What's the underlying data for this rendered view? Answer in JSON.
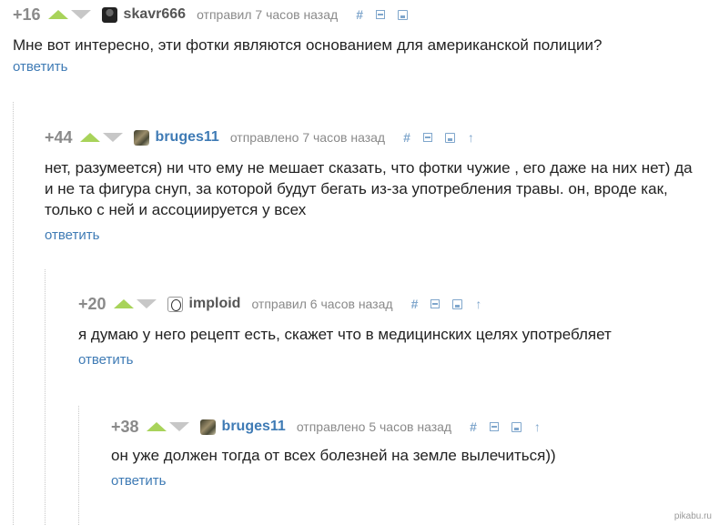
{
  "comments": [
    {
      "rating": "+16",
      "author": "skavr666",
      "meta": "отправил 7 часов назад",
      "text": "Мне вот интересно, эти фотки являются основанием для американской полиции?",
      "reply_label": "ответить",
      "hash": "#"
    },
    {
      "rating": "+44",
      "author": "bruges11",
      "meta": "отправлено 7 часов назад",
      "text": "нет, разумеется) ни что ему не мешает сказать, что фотки чужие , его даже на них нет) да и не та фигура снуп, за которой будут бегать из-за употребления травы. он, вроде как, только с ней и ассоциируется у всех",
      "reply_label": "ответить",
      "hash": "#",
      "up_arrow": "↑"
    },
    {
      "rating": "+20",
      "author": "imploid",
      "meta": "отправил 6 часов назад",
      "text": "я думаю у него рецепт есть, скажет что в медицинских целях употребляет",
      "reply_label": "ответить",
      "hash": "#",
      "up_arrow": "↑"
    },
    {
      "rating": "+38",
      "author": "bruges11",
      "meta": "отправлено 5 часов назад",
      "text": "он уже должен тогда от всех болезней на земле вылечиться))",
      "reply_label": "ответить",
      "hash": "#",
      "up_arrow": "↑"
    }
  ],
  "watermark": "pikabu.ru",
  "colors": {
    "vote_up": "#a8d35a",
    "vote_down": "#c7c7c7",
    "link": "#3f7bb5",
    "tool": "#7fa6cc",
    "meta": "#8a8a8a"
  },
  "icons": [
    "vote-up-icon",
    "vote-down-icon",
    "hash-link-icon",
    "collapse-icon",
    "save-icon",
    "parent-arrow-icon"
  ]
}
